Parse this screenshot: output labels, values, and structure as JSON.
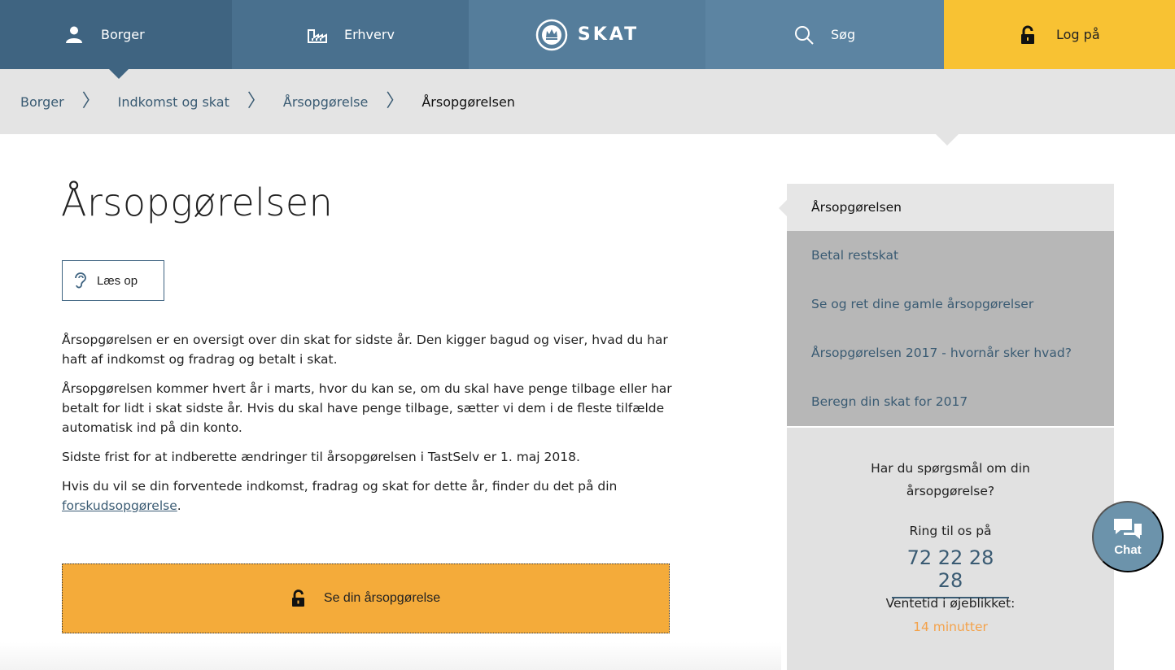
{
  "topnav": {
    "borger": "Borger",
    "erhverv": "Erhverv",
    "logo": "SKAT",
    "search": "Søg",
    "login": "Log på"
  },
  "breadcrumb": [
    "Borger",
    "Indkomst og skat",
    "Årsopgørelse",
    "Årsopgørelsen"
  ],
  "main": {
    "title": "Årsopgørelsen",
    "listen": "Læs op",
    "paragraphs": [
      "Årsopgørelsen er en oversigt over din skat for sidste år. Den kigger bagud og viser, hvad du har haft af indkomst og fradrag og betalt i skat.",
      "Årsopgørelsen kommer hvert år i marts, hvor du kan se, om du skal have penge tilbage eller har betalt for lidt i skat sidste år. Hvis du skal have penge tilbage, sætter vi dem i de fleste tilfælde automatisk ind på din konto.",
      "Sidste frist for at indberette ændringer til årsopgørelsen i TastSelv er 1. maj 2018."
    ],
    "p4_text": "Hvis du vil se din forventede indkomst, fradrag og skat for dette år, finder du det på din ",
    "p4_link": "forskudsopgørelse",
    "p4_end": ".",
    "cta": "Se din årsopgørelse"
  },
  "sidebar": {
    "current": "Årsopgørelsen",
    "links": [
      "Betal restskat",
      "Se og ret dine gamle årsopgørelser",
      "Årsopgørelsen 2017 - hvornår sker hvad?",
      "Beregn din skat for 2017"
    ],
    "help": {
      "question": "Har du spørgsmål om din årsopgørelse?",
      "call": "Ring til os på",
      "phone": "72 22 28 28",
      "wait_label": "Ventetid i øjeblikket:",
      "wait_value": "14 minutter"
    }
  },
  "chat": {
    "label": "Chat"
  },
  "colors": {
    "nav_dark": "#3f6481",
    "login_yellow": "#f8c233",
    "cta_orange": "#f4ab3a",
    "link_blue": "#3a5b73",
    "wait_orange": "#f4a24a"
  }
}
